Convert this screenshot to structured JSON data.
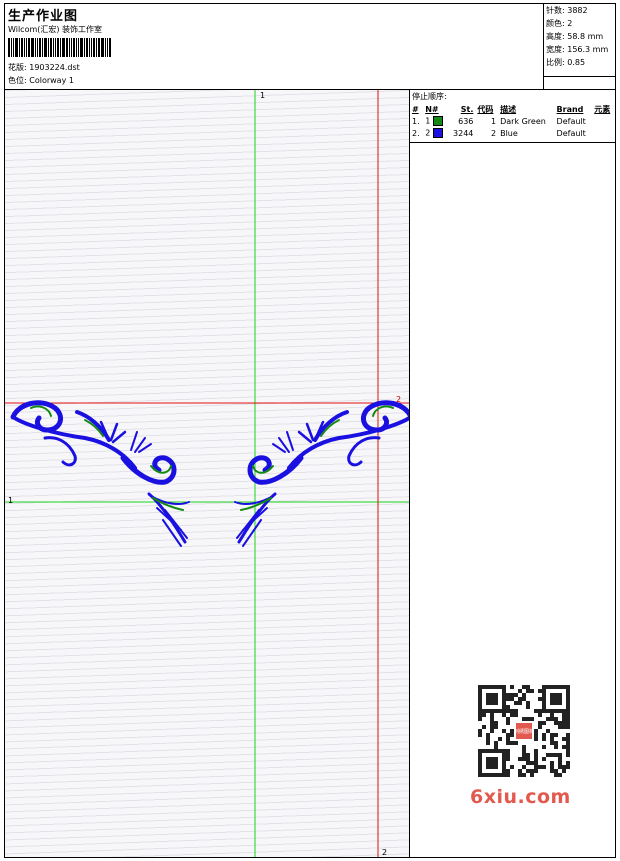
{
  "header": {
    "title": "生产作业图",
    "subtitle": "Wilcom(汇宏) 装饰工作室",
    "design_file": "花版: 1903224.dst",
    "colorway": "色位: Colorway 1"
  },
  "stats": {
    "stitches": "针数: 3882",
    "colors": "颜色: 2",
    "height": "高度: 58.8 mm",
    "width": "宽度: 156.3 mm",
    "scale": "比例: 0.85"
  },
  "guides": {
    "green_top": "1",
    "green_left": "1",
    "red_right": "2",
    "red_bottom": "2"
  },
  "sequence": {
    "label": "停止顺序:",
    "columns": [
      "#",
      "N#",
      "St.",
      "代码",
      "描述",
      "Brand",
      "元素"
    ],
    "rows": [
      {
        "idx": "1.",
        "num": "1",
        "color": "#138a13",
        "stitches": "636",
        "code": "1",
        "desc": "Dark Green",
        "brand": "Default"
      },
      {
        "idx": "2.",
        "num": "2",
        "color": "#1a10e0",
        "stitches": "3244",
        "code": "2",
        "desc": "Blue",
        "brand": "Default"
      }
    ]
  },
  "watermark": "6xiu.com",
  "qr_seal": "刺绣图档"
}
